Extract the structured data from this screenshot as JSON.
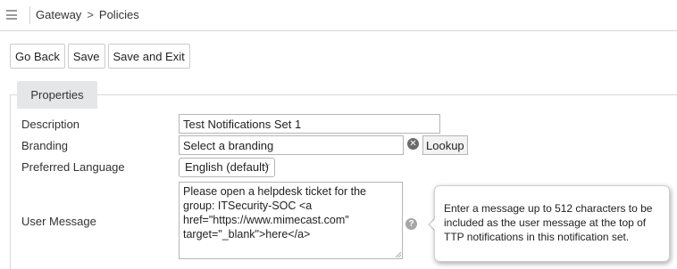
{
  "header": {
    "breadcrumb": [
      "Gateway",
      "Policies"
    ],
    "separator": ">"
  },
  "toolbar": {
    "go_back_label": "Go Back",
    "save_label": "Save",
    "save_exit_label": "Save and Exit"
  },
  "tabs": {
    "properties_label": "Properties"
  },
  "form": {
    "description": {
      "label": "Description",
      "value": "Test Notifications Set 1"
    },
    "branding": {
      "label": "Branding",
      "value": "Select a branding",
      "lookup_label": "Lookup"
    },
    "preferred_language": {
      "label": "Preferred Language",
      "value": "English (default)"
    },
    "user_message": {
      "label": "User Message",
      "value": "Please open a helpdesk ticket for the group: ITSecurity-SOC <a href=\"https://www.mimecast.com\" target=\"_blank\">here</a>"
    }
  },
  "tooltip": {
    "text": "Enter a message up to 512 characters to be included as the user message at the top of TTP notifications in this notification set."
  },
  "icons": {
    "menu": "hamburger-menu-icon",
    "clear": "clear-circle-icon",
    "help": "help-question-icon",
    "dropdown": "chevron-down-icon"
  }
}
